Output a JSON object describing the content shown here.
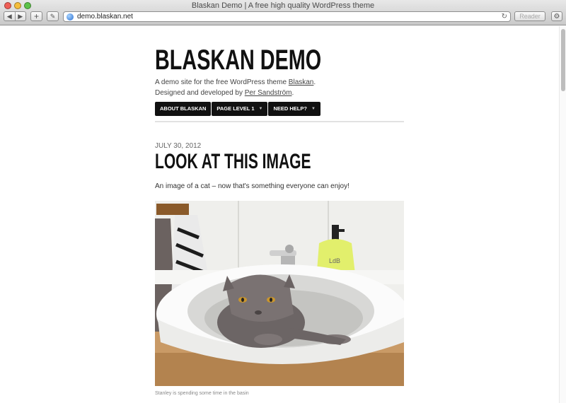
{
  "browser": {
    "window_title": "Blaskan Demo | A free high quality WordPress theme",
    "back_icon": "◀",
    "forward_icon": "▶",
    "add_icon": "+",
    "tools_icon": "✎",
    "url": "demo.blaskan.net",
    "reload_icon": "↻",
    "reader_label": "Reader",
    "gear_icon": "⚙"
  },
  "site": {
    "title": "BLASKAN DEMO",
    "desc_line1_prefix": "A demo site for the free WordPress theme ",
    "desc_line1_link": "Blaskan",
    "desc_line1_suffix": ".",
    "desc_line2_prefix": "Designed and developed by ",
    "desc_line2_link": "Per Sandström",
    "desc_line2_suffix": "."
  },
  "nav": {
    "items": [
      {
        "label": "ABOUT BLASKAN",
        "caret": ""
      },
      {
        "label": "PAGE LEVEL 1",
        "caret": "▼"
      },
      {
        "label": "NEED HELP?",
        "caret": "▼"
      }
    ]
  },
  "post": {
    "date": "JULY 30, 2012",
    "title": "LOOK AT THIS IMAGE",
    "intro": "An image of a cat – now that's something everyone can enjoy!",
    "soap_label": "LdB",
    "caption": "Stanley is spending some time in the basin"
  }
}
